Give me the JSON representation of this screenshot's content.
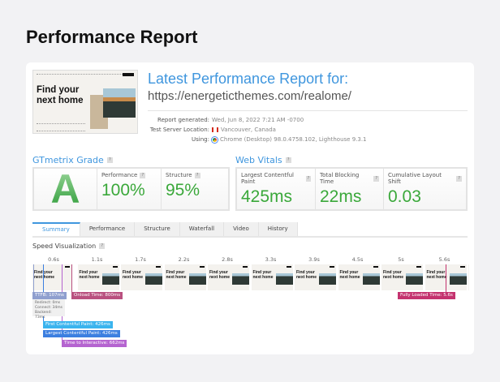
{
  "page_title": "Performance Report",
  "report": {
    "title": "Latest Performance Report for:",
    "url": "https://energeticthemes.com/realome/",
    "thumbnail_heading": "Find your next home",
    "info": [
      {
        "label": "Report generated:",
        "value": "Wed, Jun 8, 2022 7:21 AM -0700"
      },
      {
        "label": "Test Server Location:",
        "value": "Vancouver, Canada",
        "icon": "canada-flag-icon"
      },
      {
        "label": "Using:",
        "value": "Chrome (Desktop) 98.0.4758.102, Lighthouse 9.3.1",
        "icon": "chrome-icon"
      }
    ]
  },
  "grade": {
    "heading": "GTmetrix Grade",
    "grade": "A",
    "performance_label": "Performance",
    "performance": "100%",
    "structure_label": "Structure",
    "structure": "95%"
  },
  "vitals": {
    "heading": "Web Vitals",
    "items": [
      {
        "label": "Largest Contentful Paint",
        "value": "425ms"
      },
      {
        "label": "Total Blocking Time",
        "value": "22ms"
      },
      {
        "label": "Cumulative Layout Shift",
        "value": "0.03"
      }
    ]
  },
  "tabs": [
    "Summary",
    "Performance",
    "Structure",
    "Waterfall",
    "Video",
    "History"
  ],
  "active_tab": "Summary",
  "speed": {
    "heading": "Speed Visualization",
    "ticks": [
      "0.6s",
      "1.1s",
      "1.7s",
      "2.2s",
      "2.8s",
      "3.3s",
      "3.9s",
      "4.5s",
      "5s",
      "5.6s"
    ],
    "frame_text": "Find your next home",
    "ttfb": "TTFB: 107ms",
    "details": [
      "Redirect: 0ms",
      "Connect: 34ms",
      "Backend: 73ms"
    ],
    "onload": "Onload Time: 800ms",
    "fully_loaded": "Fully Loaded Time: 5.6s",
    "fcp": "First Contentful Paint: 426ms",
    "lcp": "Largest Contentful Paint: 426ms",
    "tti": "Time to Interactive: 662ms"
  },
  "colors": {
    "accent": "#3f96de",
    "good": "#3aa83a",
    "ttfb": "#8f9fcf",
    "fcp": "#3ab4ee",
    "lcp": "#3c7fe0",
    "tti": "#b564d0",
    "onload": "#b9507f",
    "fully_loaded": "#c4336f"
  }
}
